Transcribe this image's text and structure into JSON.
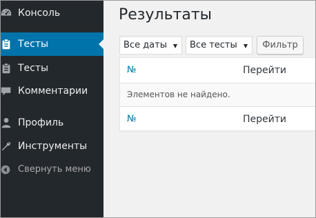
{
  "sidebar": {
    "items": [
      {
        "label": "Консоль",
        "icon": "dashboard-icon"
      },
      {
        "label": "Тесты",
        "icon": "clipboard-icon",
        "active": true
      },
      {
        "label": "Тесты",
        "icon": "clipboard-icon"
      },
      {
        "label": "Комментарии",
        "icon": "comment-bubble-icon"
      },
      {
        "label": "Профиль",
        "icon": "user-icon"
      },
      {
        "label": "Инструменты",
        "icon": "wrench-icon"
      }
    ],
    "collapse_label": "Свернуть меню",
    "collapse_icon": "collapse-arrow-icon"
  },
  "main": {
    "title": "Результаты",
    "filters": {
      "dates_value": "Все даты",
      "tests_value": "Все тесты",
      "filter_button": "Фильтр"
    },
    "table": {
      "columns": [
        "№",
        "Перейти"
      ],
      "empty_message": "Элементов не найдено.",
      "footer_columns": [
        "№",
        "Перейти"
      ]
    }
  },
  "colors": {
    "sidebar_bg": "#23282d",
    "active_item_bg": "#0073aa",
    "link": "#0073aa",
    "page_bg": "#f1f1f1"
  }
}
